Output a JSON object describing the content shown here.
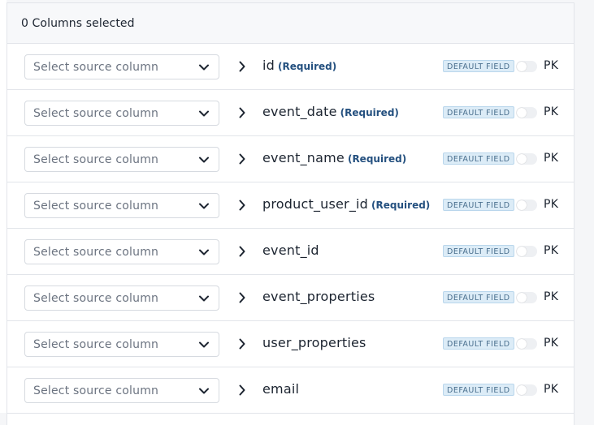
{
  "header": {
    "title": "0 Columns selected"
  },
  "select_placeholder": "Select source column",
  "badge_label": "DEFAULT FIELD",
  "pk_label": "PK",
  "rows": [
    {
      "field": "id",
      "required": "(Required)",
      "pk_on": false
    },
    {
      "field": "event_date",
      "required": "(Required)",
      "pk_on": false
    },
    {
      "field": "event_name",
      "required": "(Required)",
      "pk_on": false
    },
    {
      "field": "product_user_id",
      "required": "(Required)",
      "pk_on": false
    },
    {
      "field": "event_id",
      "required": "",
      "pk_on": false
    },
    {
      "field": "event_properties",
      "required": "",
      "pk_on": false
    },
    {
      "field": "user_properties",
      "required": "",
      "pk_on": false
    },
    {
      "field": "email",
      "required": "",
      "pk_on": false
    }
  ],
  "icons": {
    "select_chevron": "chevron-down-icon",
    "mapping_arrow": "chevron-right-icon"
  },
  "colors": {
    "badge_bg": "#dcecf7",
    "badge_text": "#4a6f8e",
    "required_text": "#24507f",
    "toggle_off": "#eef0f3"
  }
}
